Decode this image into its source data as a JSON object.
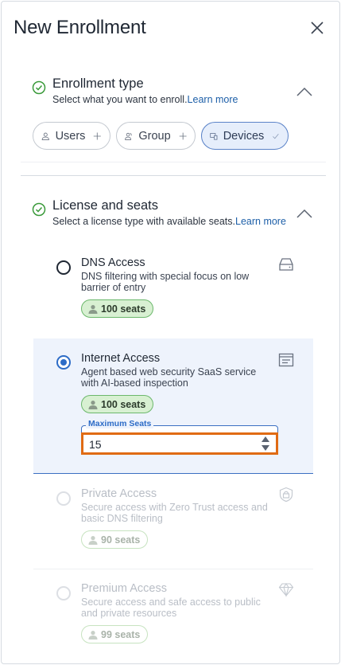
{
  "header": {
    "title": "New Enrollment"
  },
  "enrollment_type": {
    "title": "Enrollment type",
    "subtitle": "Select what you want to enroll.",
    "link": "Learn more",
    "options": [
      {
        "label": "Users",
        "icon": "user-icon",
        "action": "plus-icon"
      },
      {
        "label": "Group",
        "icon": "group-icon",
        "action": "plus-icon"
      },
      {
        "label": "Devices",
        "icon": "devices-icon",
        "action": "check-icon",
        "selected": true
      }
    ]
  },
  "license": {
    "title": "License and seats",
    "subtitle": "Select a license type with available seats.",
    "link": "Learn more",
    "items": [
      {
        "name": "DNS Access",
        "desc": "DNS filtering with special focus on low barrier of entry",
        "seats": "100 seats",
        "icon": "server-icon"
      },
      {
        "name": "Internet Access",
        "desc": "Agent based web security SaaS service with AI-based inspection",
        "seats": "100 seats",
        "icon": "browser-icon",
        "selected": true
      },
      {
        "name": "Private Access",
        "desc": "Secure access with Zero Trust access and basic DNS filtering",
        "seats": "90 seats",
        "icon": "lock-icon",
        "disabled": true
      },
      {
        "name": "Premium Access",
        "desc": "Secure access and safe access to public and private resources",
        "seats": "99 seats",
        "icon": "diamond-icon",
        "disabled": true
      }
    ],
    "max_seats": {
      "label": "Maximum Seats",
      "value": "15"
    }
  },
  "colors": {
    "accent": "#2d6cc7",
    "seat_badge": "#d8f0d2",
    "focus": "#e06b14"
  }
}
